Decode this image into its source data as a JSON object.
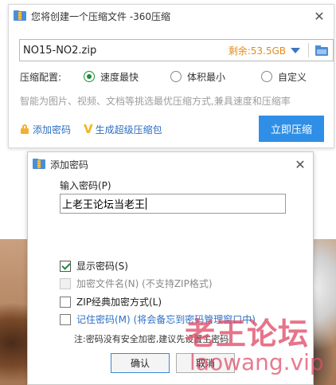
{
  "main_window": {
    "title": "您将创建一个压缩文件 -360压缩",
    "close_glyph": "✕",
    "file_name": "NO15-NO2.zip",
    "free_space": "剩余:53.5GB",
    "config_label": "压缩配置:",
    "options": [
      {
        "label": "速度最快",
        "selected": true
      },
      {
        "label": "体积最小",
        "selected": false
      },
      {
        "label": "自定义",
        "selected": false
      }
    ],
    "hint": "智能为图片、视频、文档等挑选最优压缩方式,兼具速度和压缩率",
    "add_password_link": "添加密码",
    "super_zip_link": "生成超级压缩包",
    "compress_button": "立即压缩",
    "accent_color": "#2f8fe6"
  },
  "password_dialog": {
    "title": "添加密码",
    "close_glyph": "✕",
    "input_label": "输入密码(P)",
    "password_value": "上老王论坛当老王",
    "checkboxes": [
      {
        "label": "显示密码(S)",
        "checked": true,
        "disabled": false
      },
      {
        "label": "加密文件名(N) (不支持ZIP格式)",
        "checked": false,
        "disabled": true
      },
      {
        "label": "ZIP经典加密方式(L)",
        "checked": false,
        "disabled": false
      },
      {
        "label": "记住密码(M) (将会备忘到密码管理窗口中)",
        "checked": false,
        "disabled": false
      }
    ],
    "note": "注:密码没有安全加密,建议先设置主密码",
    "ok_button": "确认",
    "cancel_button": "取消"
  },
  "watermark": {
    "cn": "老王论坛",
    "en": "laowang.vip"
  }
}
